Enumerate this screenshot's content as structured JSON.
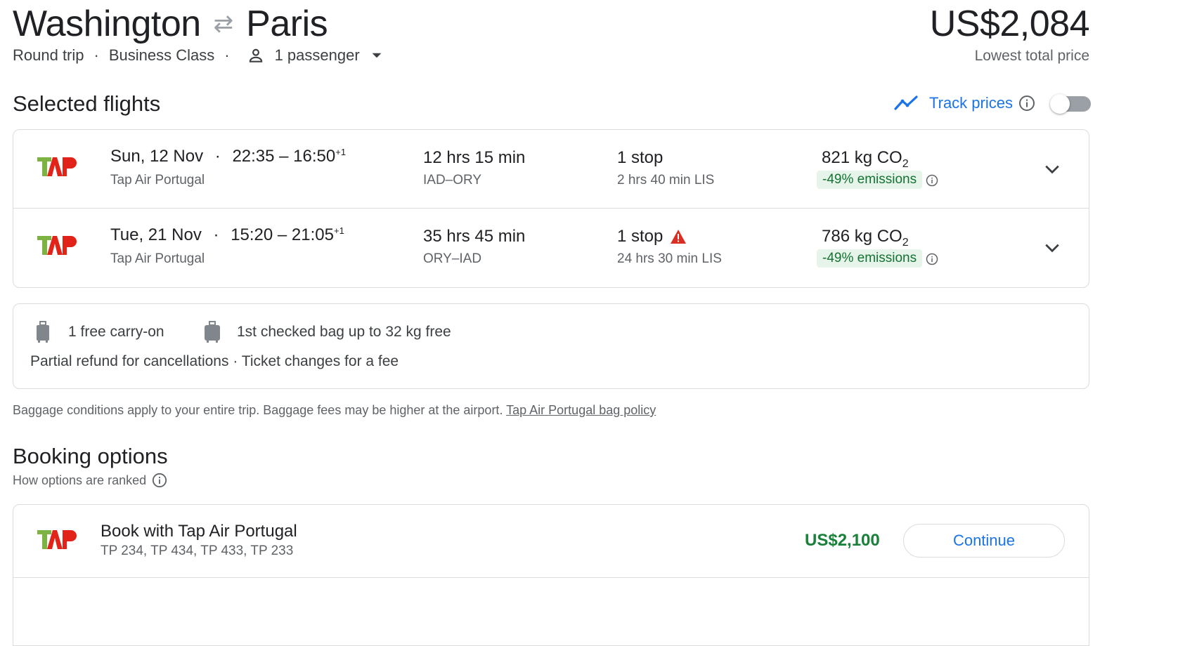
{
  "header": {
    "origin": "Washington",
    "destination": "Paris",
    "trip_type": "Round trip",
    "cabin_class": "Business Class",
    "passengers": "1 passenger",
    "total_price": "US$2,084",
    "price_label": "Lowest total price"
  },
  "selected_flights": {
    "title": "Selected flights",
    "track_prices_label": "Track prices",
    "flights": [
      {
        "date": "Sun, 12 Nov",
        "times": "22:35 – 16:50",
        "day_offset": "+1",
        "airline": "Tap Air Portugal",
        "duration": "12 hrs 15 min",
        "route": "IAD–ORY",
        "stops": "1 stop",
        "layover": "2 hrs 40 min LIS",
        "co2_value": "821 kg CO",
        "co2_sub": "2",
        "emissions": "-49% emissions"
      },
      {
        "date": "Tue, 21 Nov",
        "times": "15:20 – 21:05",
        "day_offset": "+1",
        "airline": "Tap Air Portugal",
        "duration": "35 hrs 45 min",
        "route": "ORY–IAD",
        "stops": "1 stop",
        "layover": "24 hrs 30 min LIS",
        "co2_value": "786 kg CO",
        "co2_sub": "2",
        "emissions": "-49% emissions"
      }
    ]
  },
  "baggage": {
    "carry_on": "1 free carry-on",
    "checked": "1st checked bag up to 32 kg free",
    "policy": "Partial refund for cancellations · Ticket changes for a fee",
    "note": "Baggage conditions apply to your entire trip. Baggage fees may be higher at the airport.",
    "link": "Tap Air Portugal bag policy"
  },
  "booking": {
    "title": "Booking options",
    "ranked_label": "How options are ranked",
    "option_title": "Book with Tap Air Portugal",
    "flight_numbers": "TP 234, TP 434, TP 433, TP 233",
    "price": "US$2,100",
    "continue_label": "Continue"
  },
  "colors": {
    "accent": "#1a73e8",
    "price_green": "#188038",
    "emissions_bg": "#e6f4ea",
    "warning_red": "#d93025",
    "tap_red": "#e2231a",
    "tap_green": "#7cb342"
  }
}
